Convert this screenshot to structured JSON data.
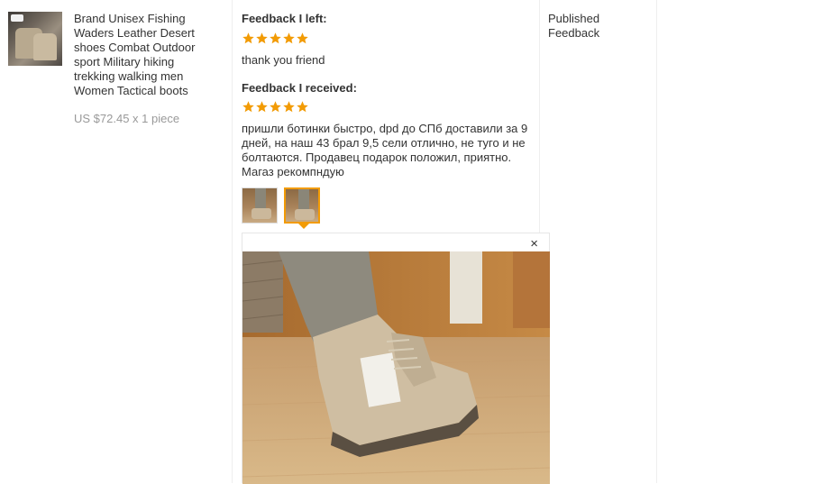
{
  "product": {
    "title": "Brand Unisex Fishing Waders Leather Desert shoes Combat Outdoor sport Military hiking trekking walking men Women Tactical boots",
    "price": "US $72.45 x 1 piece"
  },
  "feedback_left": {
    "heading": "Feedback I left:",
    "rating": 5,
    "text": "thank you friend"
  },
  "feedback_received": {
    "heading": "Feedback I received:",
    "rating": 5,
    "text": "пришли ботинки быстро, dpd до СПб доставили за 9 дней, на наш 43 брал 9,5 сели отлично, не туго и не болтаются. Продавец подарок положил, приятно. Магаз рекомпндую"
  },
  "viewer": {
    "close_symbol": "×"
  },
  "status": {
    "label": "Published Feedback"
  },
  "colors": {
    "star": "#f29b05",
    "active_border": "#f29b05",
    "divider": "#eeeeee"
  },
  "icons": [
    "star-icon",
    "close-icon"
  ]
}
